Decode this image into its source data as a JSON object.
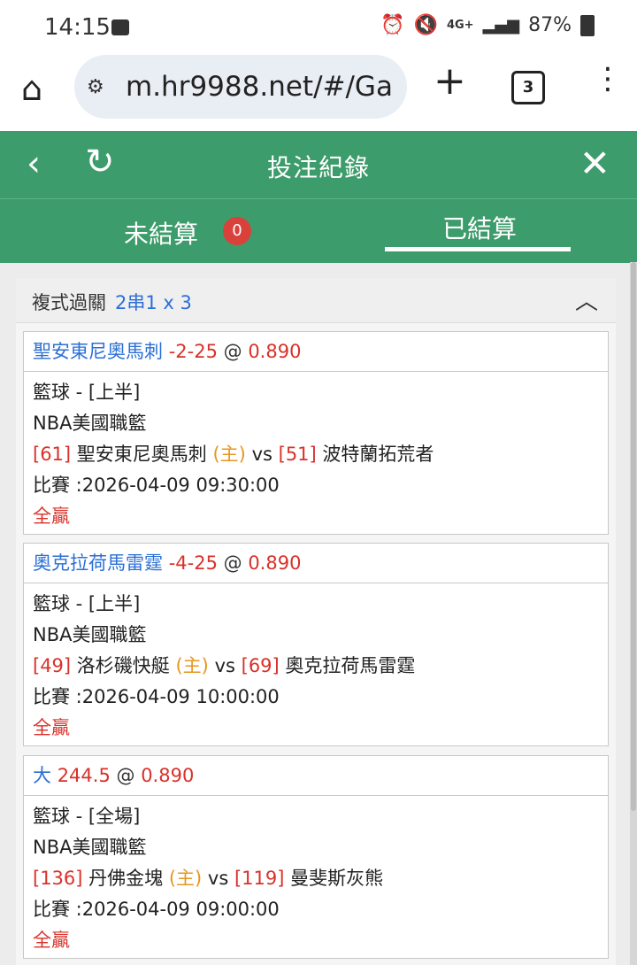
{
  "status_bar": {
    "time": "14:15",
    "battery": "87%",
    "network": "4G+"
  },
  "browser": {
    "url": "m.hr9988.net/#/Ga",
    "tab_count": "3"
  },
  "header": {
    "title": "投注紀錄"
  },
  "tabs": {
    "unsettled": "未結算",
    "unsettled_count": "0",
    "settled": "已結算"
  },
  "bet": {
    "type": "複式過關",
    "combo": "2串1 x 3",
    "legs": [
      {
        "pick": "聖安東尼奧馬刺",
        "line": "-2-25",
        "at": "@",
        "odds": "0.890",
        "sport": "籃球 - [上半]",
        "league": "NBA美國職籃",
        "home_no": "[61]",
        "home": "聖安東尼奧馬刺",
        "home_tag": "(主)",
        "vs": "vs",
        "away_no": "[51]",
        "away": "波特蘭拓荒者",
        "match_time": "比賽 :2026-04-09 09:30:00",
        "result": "全贏"
      },
      {
        "pick": "奧克拉荷馬雷霆",
        "line": "-4-25",
        "at": "@",
        "odds": "0.890",
        "sport": "籃球 - [上半]",
        "league": "NBA美國職籃",
        "home_no": "[49]",
        "home": "洛杉磯快艇",
        "home_tag": "(主)",
        "vs": "vs",
        "away_no": "[69]",
        "away": "奧克拉荷馬雷霆",
        "match_time": "比賽 :2026-04-09 10:00:00",
        "result": "全贏"
      },
      {
        "pick": "大",
        "line": "244.5",
        "at": "@",
        "odds": "0.890",
        "sport": "籃球 - [全場]",
        "league": "NBA美國職籃",
        "home_no": "[136]",
        "home": "丹佛金塊",
        "home_tag": "(主)",
        "vs": "vs",
        "away_no": "[119]",
        "away": "曼斐斯灰熊",
        "match_time": "比賽 :2026-04-09 09:00:00",
        "result": "全贏"
      }
    ]
  },
  "colors": {
    "header_green": "#3d9c6b",
    "badge_red": "#d9413a",
    "link_blue": "#2b6fd6",
    "value_red": "#d9312a",
    "home_orange": "#e6961e"
  }
}
